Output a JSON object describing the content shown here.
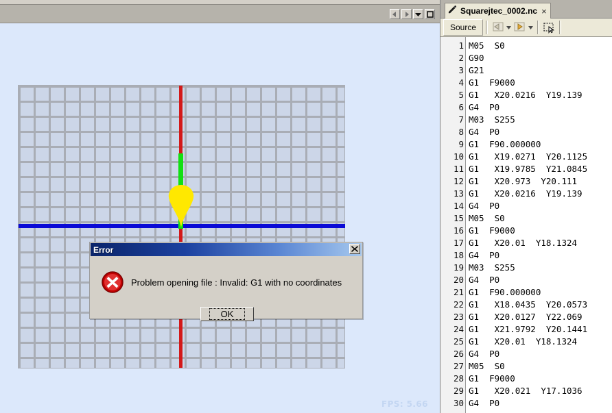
{
  "viewer": {
    "nav_buttons": [
      {
        "name": "previous-button",
        "icon": "triangle-left-icon"
      },
      {
        "name": "next-button",
        "icon": "triangle-right-icon"
      },
      {
        "name": "dropdown-button",
        "icon": "triangle-down-icon"
      },
      {
        "name": "maximize-button",
        "icon": "square-icon"
      }
    ],
    "fps_label": "FPS: 5.66",
    "colors": {
      "background": "#dce8fb",
      "grid_cell": "#ccd6e8",
      "grid_line": "#a9adb5",
      "axis_vertical": "#d31919",
      "axis_horizontal": "#0a0ad6",
      "toolpath": "#12e012",
      "tool_cone": "#ffe800"
    }
  },
  "dialog": {
    "title": "Error",
    "message": "Problem opening file : Invalid: G1 with no coordinates",
    "ok_label": "OK",
    "close_label": "×",
    "icon": "error-x-icon"
  },
  "editor": {
    "tab": {
      "label": "Squarejtec_0002.nc",
      "close": "×",
      "icon": "pencil-icon"
    },
    "toolbar": {
      "source_label": "Source",
      "back_icon": "back-arrow-icon",
      "forward_icon": "forward-arrow-icon",
      "dropdown_icon": "chevron-down-icon",
      "select_icon": "selection-tool-icon"
    },
    "code": {
      "lines": [
        {
          "n": "1",
          "text": "M05  S0"
        },
        {
          "n": "2",
          "text": "G90"
        },
        {
          "n": "3",
          "text": "G21"
        },
        {
          "n": "4",
          "text": "G1  F9000"
        },
        {
          "n": "5",
          "text": "G1   X20.0216  Y19.139"
        },
        {
          "n": "6",
          "text": "G4  P0"
        },
        {
          "n": "7",
          "text": "M03  S255"
        },
        {
          "n": "8",
          "text": "G4  P0"
        },
        {
          "n": "9",
          "text": "G1  F90.000000"
        },
        {
          "n": "10",
          "text": "G1   X19.0271  Y20.1125"
        },
        {
          "n": "11",
          "text": "G1   X19.9785  Y21.0845"
        },
        {
          "n": "12",
          "text": "G1   X20.973  Y20.111"
        },
        {
          "n": "13",
          "text": "G1   X20.0216  Y19.139"
        },
        {
          "n": "14",
          "text": "G4  P0"
        },
        {
          "n": "15",
          "text": "M05  S0"
        },
        {
          "n": "16",
          "text": "G1  F9000"
        },
        {
          "n": "17",
          "text": "G1   X20.01  Y18.1324"
        },
        {
          "n": "18",
          "text": "G4  P0"
        },
        {
          "n": "19",
          "text": "M03  S255"
        },
        {
          "n": "20",
          "text": "G4  P0"
        },
        {
          "n": "21",
          "text": "G1  F90.000000"
        },
        {
          "n": "22",
          "text": "G1   X18.0435  Y20.0573"
        },
        {
          "n": "23",
          "text": "G1   X20.0127  Y22.069"
        },
        {
          "n": "24",
          "text": "G1   X21.9792  Y20.1441"
        },
        {
          "n": "25",
          "text": "G1   X20.01  Y18.1324"
        },
        {
          "n": "26",
          "text": "G4  P0"
        },
        {
          "n": "27",
          "text": "M05  S0"
        },
        {
          "n": "28",
          "text": "G1  F9000"
        },
        {
          "n": "29",
          "text": "G1   X20.021  Y17.1036"
        },
        {
          "n": "30",
          "text": "G4  P0"
        }
      ]
    }
  }
}
